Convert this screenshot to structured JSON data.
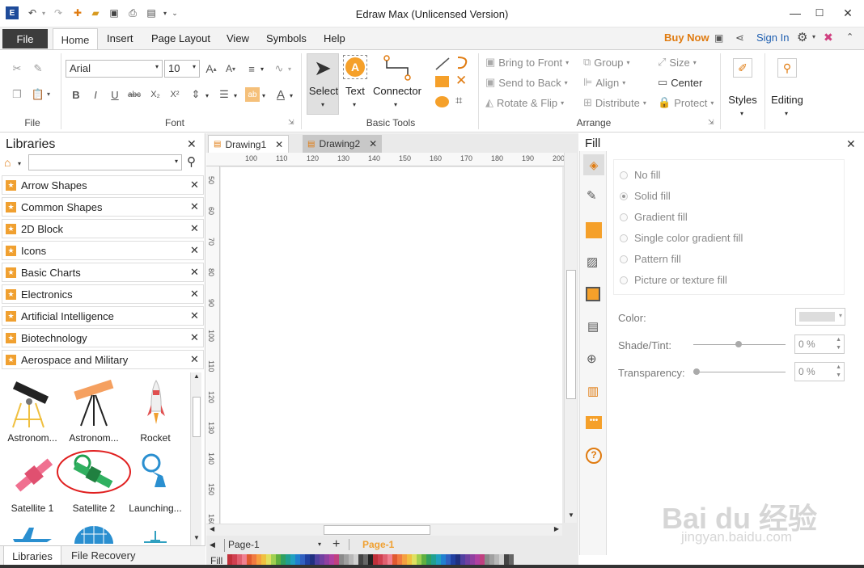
{
  "titlebar": {
    "title": "Edraw Max (Unlicensed Version)"
  },
  "menu": {
    "file": "File",
    "home": "Home",
    "insert": "Insert",
    "page_layout": "Page Layout",
    "view": "View",
    "symbols": "Symbols",
    "help": "Help",
    "buy_now": "Buy Now",
    "sign_in": "Sign In"
  },
  "ribbon": {
    "groups": {
      "file": "File",
      "font": "Font",
      "basic_tools": "Basic Tools",
      "arrange": "Arrange"
    },
    "font_name": "Arial",
    "font_size": "10",
    "tools": {
      "select": "Select",
      "text": "Text",
      "text_glyph": "A",
      "connector": "Connector"
    },
    "arrange": {
      "bring_to_front": "Bring to Front",
      "send_to_back": "Send to Back",
      "rotate_flip": "Rotate & Flip",
      "group": "Group",
      "align": "Align",
      "distribute": "Distribute",
      "size": "Size",
      "center": "Center",
      "protect": "Protect"
    },
    "styles": "Styles",
    "editing": "Editing"
  },
  "libraries": {
    "title": "Libraries",
    "items": [
      "Arrow Shapes",
      "Common Shapes",
      "2D Block",
      "Icons",
      "Basic Charts",
      "Electronics",
      "Artificial Intelligence",
      "Biotechnology",
      "Aerospace and Military"
    ],
    "shapes": [
      "Astronom...",
      "Astronom...",
      "Rocket",
      "Satellite 1",
      "Satellite 2",
      "Launching..."
    ],
    "bottom_tabs": {
      "libraries": "Libraries",
      "file_recovery": "File Recovery"
    }
  },
  "documents": {
    "tabs": [
      "Drawing1",
      "Drawing2"
    ],
    "ruler_h": [
      "100",
      "110",
      "120",
      "130",
      "140",
      "150",
      "160",
      "170",
      "180",
      "190",
      "200"
    ],
    "ruler_v": [
      "50",
      "60",
      "70",
      "80",
      "90",
      "100",
      "110",
      "120",
      "130",
      "140",
      "150",
      "160"
    ],
    "page_select": "Page-1",
    "page_tab": "Page-1",
    "fill_label": "Fill"
  },
  "fill_panel": {
    "title": "Fill",
    "options": [
      "No fill",
      "Solid fill",
      "Gradient fill",
      "Single color gradient fill",
      "Pattern fill",
      "Picture or texture fill"
    ],
    "selected_option": "Solid fill",
    "color_label": "Color:",
    "shade_label": "Shade/Tint:",
    "transparency_label": "Transparency:",
    "shade_value": "0 %",
    "transparency_value": "0 %"
  },
  "watermark": {
    "brand": "Bai du 经验",
    "url": "jingyan.baidu.com"
  },
  "colors": {
    "accent": "#e07b10",
    "file_tab": "#3c3c3c",
    "orange": "#f5a02a",
    "sign_in": "#1f5fb0"
  }
}
